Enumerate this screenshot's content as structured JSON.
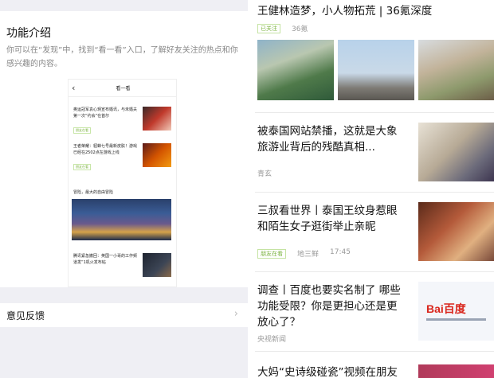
{
  "left": {
    "feature_title": "功能介绍",
    "feature_desc": "你可以在“发现”中，找到“看一看”入口，了解好友关注的热点和你感兴趣的内容。",
    "mock": {
      "back_glyph": "‹",
      "title": "看一看",
      "items": [
        {
          "text": "奥运冠军袁心玥宣布婚讯，与未婚夫第一次“约会”在首尔",
          "tag": "朋友在看"
        },
        {
          "text": "王者荣耀：貂蝉七号最新皮肤！游戏已经在2502点在游戏上线",
          "tag": "朋友在看"
        }
      ],
      "big_title": "冒险，最大的自由冒险",
      "last_item": {
        "text": "腾讯紧急撤回：英国一小哥的工作频道发“1机火发布帖",
        "tag": ""
      }
    },
    "feedback_label": "意见反馈",
    "feedback_chevron": "›"
  },
  "right": {
    "articles": [
      {
        "title": "王健林造梦，小人物拓荒 | 36氪深度",
        "tag": "已关注",
        "source": "36氪",
        "time": ""
      },
      {
        "title_lines": [
          "被泰国网站禁播，这就是大象",
          "旅游业背后的残酷真相..."
        ],
        "source": "青玄"
      },
      {
        "title_lines": [
          "三叔看世界丨泰国王纹身惹眼",
          "和陌生女子逛街举止亲昵"
        ],
        "tag": "朋友在看",
        "source": "地三鲜",
        "time": "17:45"
      },
      {
        "title_lines": [
          "调查丨百度也要实名制了 哪些",
          "功能受限？你是更担心还是更",
          "放心了？"
        ],
        "source": "央视新闻",
        "logo_text": "Bai百度"
      },
      {
        "title": "大妈“史诗级碰瓷”视频在朋友"
      }
    ]
  },
  "colors": {
    "tag_green": "#7cb342",
    "bg_gray": "#efeff4"
  }
}
